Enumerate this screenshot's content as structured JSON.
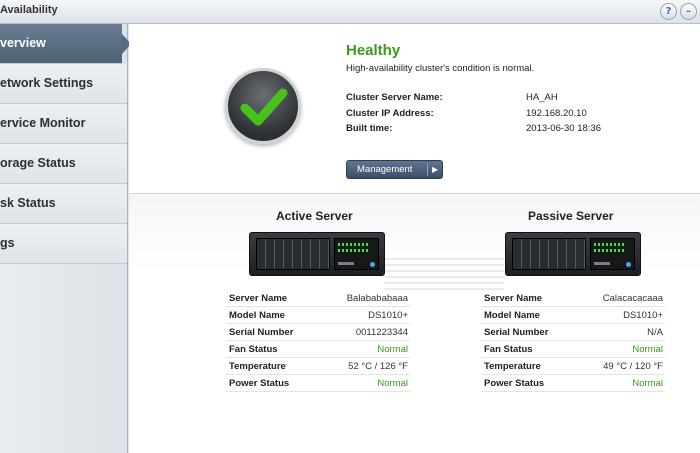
{
  "window": {
    "title": "Availability"
  },
  "sidebar": {
    "items": [
      {
        "label": "verview",
        "active": true
      },
      {
        "label": "etwork Settings"
      },
      {
        "label": "ervice Monitor"
      },
      {
        "label": "orage Status"
      },
      {
        "label": "sk Status"
      },
      {
        "label": "gs"
      }
    ]
  },
  "status": {
    "title": "Healthy",
    "description": "High-availability cluster's condition is normal.",
    "fields": [
      {
        "label": "Cluster Server Name:",
        "value": "HA_AH"
      },
      {
        "label": "Cluster IP Address:",
        "value": "192.168.20.10"
      },
      {
        "label": "Built time:",
        "value": "2013-06-30 18:36"
      }
    ],
    "management_label": "Management"
  },
  "active": {
    "title": "Active Server",
    "rows": [
      {
        "label": "Server Name",
        "value": "Balabababaaa"
      },
      {
        "label": "Model Name",
        "value": "DS1010+"
      },
      {
        "label": "Serial Number",
        "value": "0011223344"
      },
      {
        "label": "Fan Status",
        "value": "Normal"
      },
      {
        "label": "Temperature",
        "value": "52 °C / 126 °F"
      },
      {
        "label": "Power Status",
        "value": "Normal"
      }
    ]
  },
  "passive": {
    "title": "Passive Server",
    "rows": [
      {
        "label": "Server Name",
        "value": "Calacacacaaa"
      },
      {
        "label": "Model Name",
        "value": "DS1010+"
      },
      {
        "label": "Serial Number",
        "value": "N/A"
      },
      {
        "label": "Fan Status",
        "value": "Normal"
      },
      {
        "label": "Temperature",
        "value": "49 °C / 120 °F"
      },
      {
        "label": "Power Status",
        "value": "Normal"
      }
    ]
  },
  "colors": {
    "healthy": "#3c9a1c",
    "nav_active": "#566a80"
  }
}
